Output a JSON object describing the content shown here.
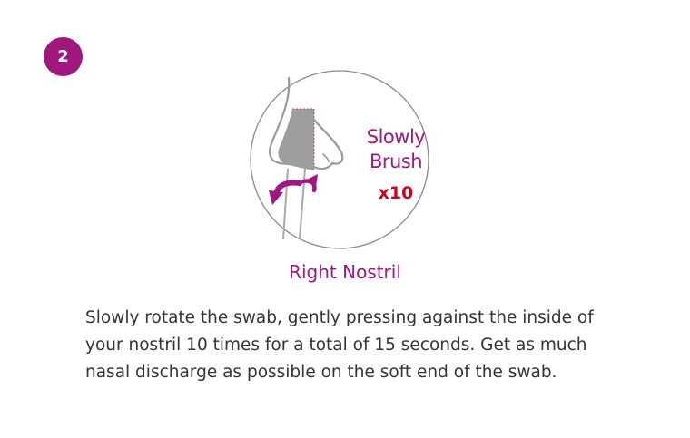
{
  "step": {
    "number": "2"
  },
  "illustration": {
    "brush_line1": "Slowly",
    "brush_line2": "Brush",
    "count": "x10",
    "icons": [
      "nose-illustration",
      "swab-icon",
      "rotation-arrow-icon"
    ]
  },
  "caption": "Right Nostril",
  "instructions": "Slowly rotate the swab, gently pressing against the inside of your nostril 10 times for a total of 15 seconds. Get as much nasal discharge as possible on the soft end of the swab.",
  "colors": {
    "accent": "#a0177e",
    "count": "#d0021b",
    "text": "#333333"
  }
}
